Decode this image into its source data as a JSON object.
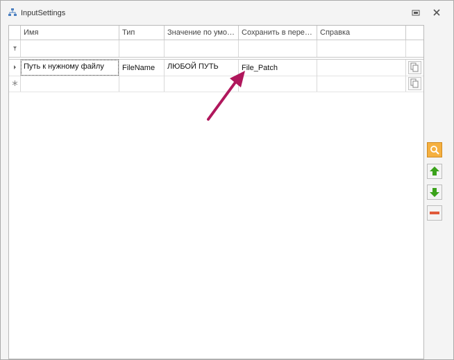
{
  "window": {
    "title": "InputSettings"
  },
  "grid": {
    "columns": [
      "Имя",
      "Тип",
      "Значение по умо…",
      "Сохранить в пере…",
      "Справка"
    ],
    "rows": [
      {
        "name": "Путь к нужному файлу",
        "type": "FileName",
        "default": "ЛЮБОЙ ПУТЬ",
        "save_to": "File_Patch",
        "help": ""
      }
    ]
  },
  "colors": {
    "arrow": "#b0175c",
    "search_button": "#f0a030",
    "move_button": "#3aa21a",
    "remove_button": "#e05a3a"
  },
  "icons": {
    "title": "tree-icon",
    "restore": "restore-icon",
    "close": "close-icon",
    "filter": "filter-row-icon",
    "current_row": "current-row-icon",
    "new_row": "new-row-icon",
    "copy": "copy-icon",
    "search": "search-icon",
    "up": "arrow-up-icon",
    "down": "arrow-down-icon",
    "remove": "minus-icon"
  }
}
